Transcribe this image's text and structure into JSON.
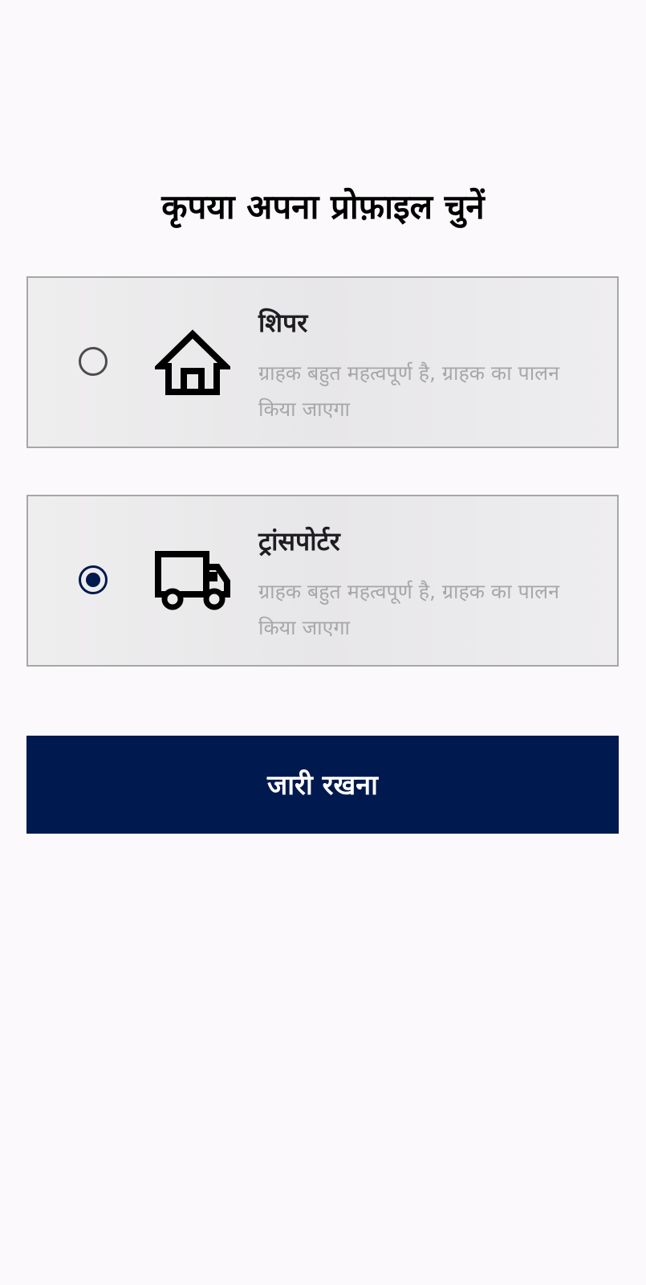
{
  "header": {
    "title": "कृपया अपना प्रोफ़ाइल चुनें"
  },
  "profiles": [
    {
      "title": "शिपर",
      "description": "ग्राहक बहुत महत्वपूर्ण है, ग्राहक का पालन किया जाएगा",
      "icon": "home-icon",
      "selected": false
    },
    {
      "title": "ट्रांसपोर्टर",
      "description": "ग्राहक बहुत महत्वपूर्ण है, ग्राहक का पालन किया जाएगा",
      "icon": "truck-icon",
      "selected": true
    }
  ],
  "continue_button": {
    "label": "जारी रखना"
  },
  "colors": {
    "background": "#fcf9fc",
    "card_background": "#ebeaec",
    "card_border": "#a7a6a8",
    "accent": "#00194f",
    "radio_unselected": "#4d4b50",
    "description_text": "#a7a6a8"
  }
}
